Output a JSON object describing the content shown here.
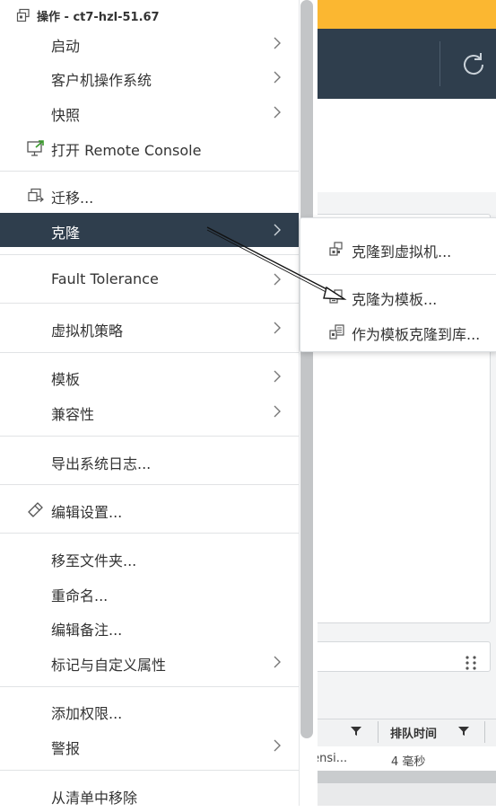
{
  "menu": {
    "header": "操作 - ct7-hzl-51.67",
    "items": [
      {
        "label": "启动",
        "submenu": true
      },
      {
        "label": "客户机操作系统",
        "submenu": true
      },
      {
        "label": "快照",
        "submenu": true
      },
      {
        "label": "打开 Remote Console",
        "submenu": false,
        "icon": "remote-console-icon"
      },
      {
        "label": "迁移...",
        "submenu": false,
        "icon": "migrate-icon"
      },
      {
        "label": "克隆",
        "submenu": true,
        "active": true
      },
      {
        "label": "Fault Tolerance",
        "submenu": true
      },
      {
        "label": "虚拟机策略",
        "submenu": true
      },
      {
        "label": "模板",
        "submenu": true
      },
      {
        "label": "兼容性",
        "submenu": true
      },
      {
        "label": "导出系统日志...",
        "submenu": false
      },
      {
        "label": "编辑设置...",
        "submenu": false,
        "icon": "edit-settings-icon"
      },
      {
        "label": "移至文件夹...",
        "submenu": false
      },
      {
        "label": "重命名...",
        "submenu": false
      },
      {
        "label": "编辑备注...",
        "submenu": false
      },
      {
        "label": "标记与自定义属性",
        "submenu": true
      },
      {
        "label": "添加权限...",
        "submenu": false
      },
      {
        "label": "警报",
        "submenu": true
      },
      {
        "label": "从清单中移除",
        "submenu": false
      }
    ]
  },
  "submenu": {
    "items": [
      {
        "label": "克隆到虚拟机...",
        "icon": "clone-to-vm-icon"
      },
      {
        "label": "克隆为模板...",
        "icon": "clone-to-template-icon"
      },
      {
        "label": "作为模板克隆到库...",
        "icon": "clone-to-library-icon"
      }
    ]
  },
  "background": {
    "table": {
      "column_queue_time": "排队时间",
      "cell_1": "tensi...",
      "cell_2": "4 毫秒"
    }
  },
  "colors": {
    "active_bg": "#2f3e4d",
    "header_yellow": "#fbb731",
    "text": "#333333"
  }
}
